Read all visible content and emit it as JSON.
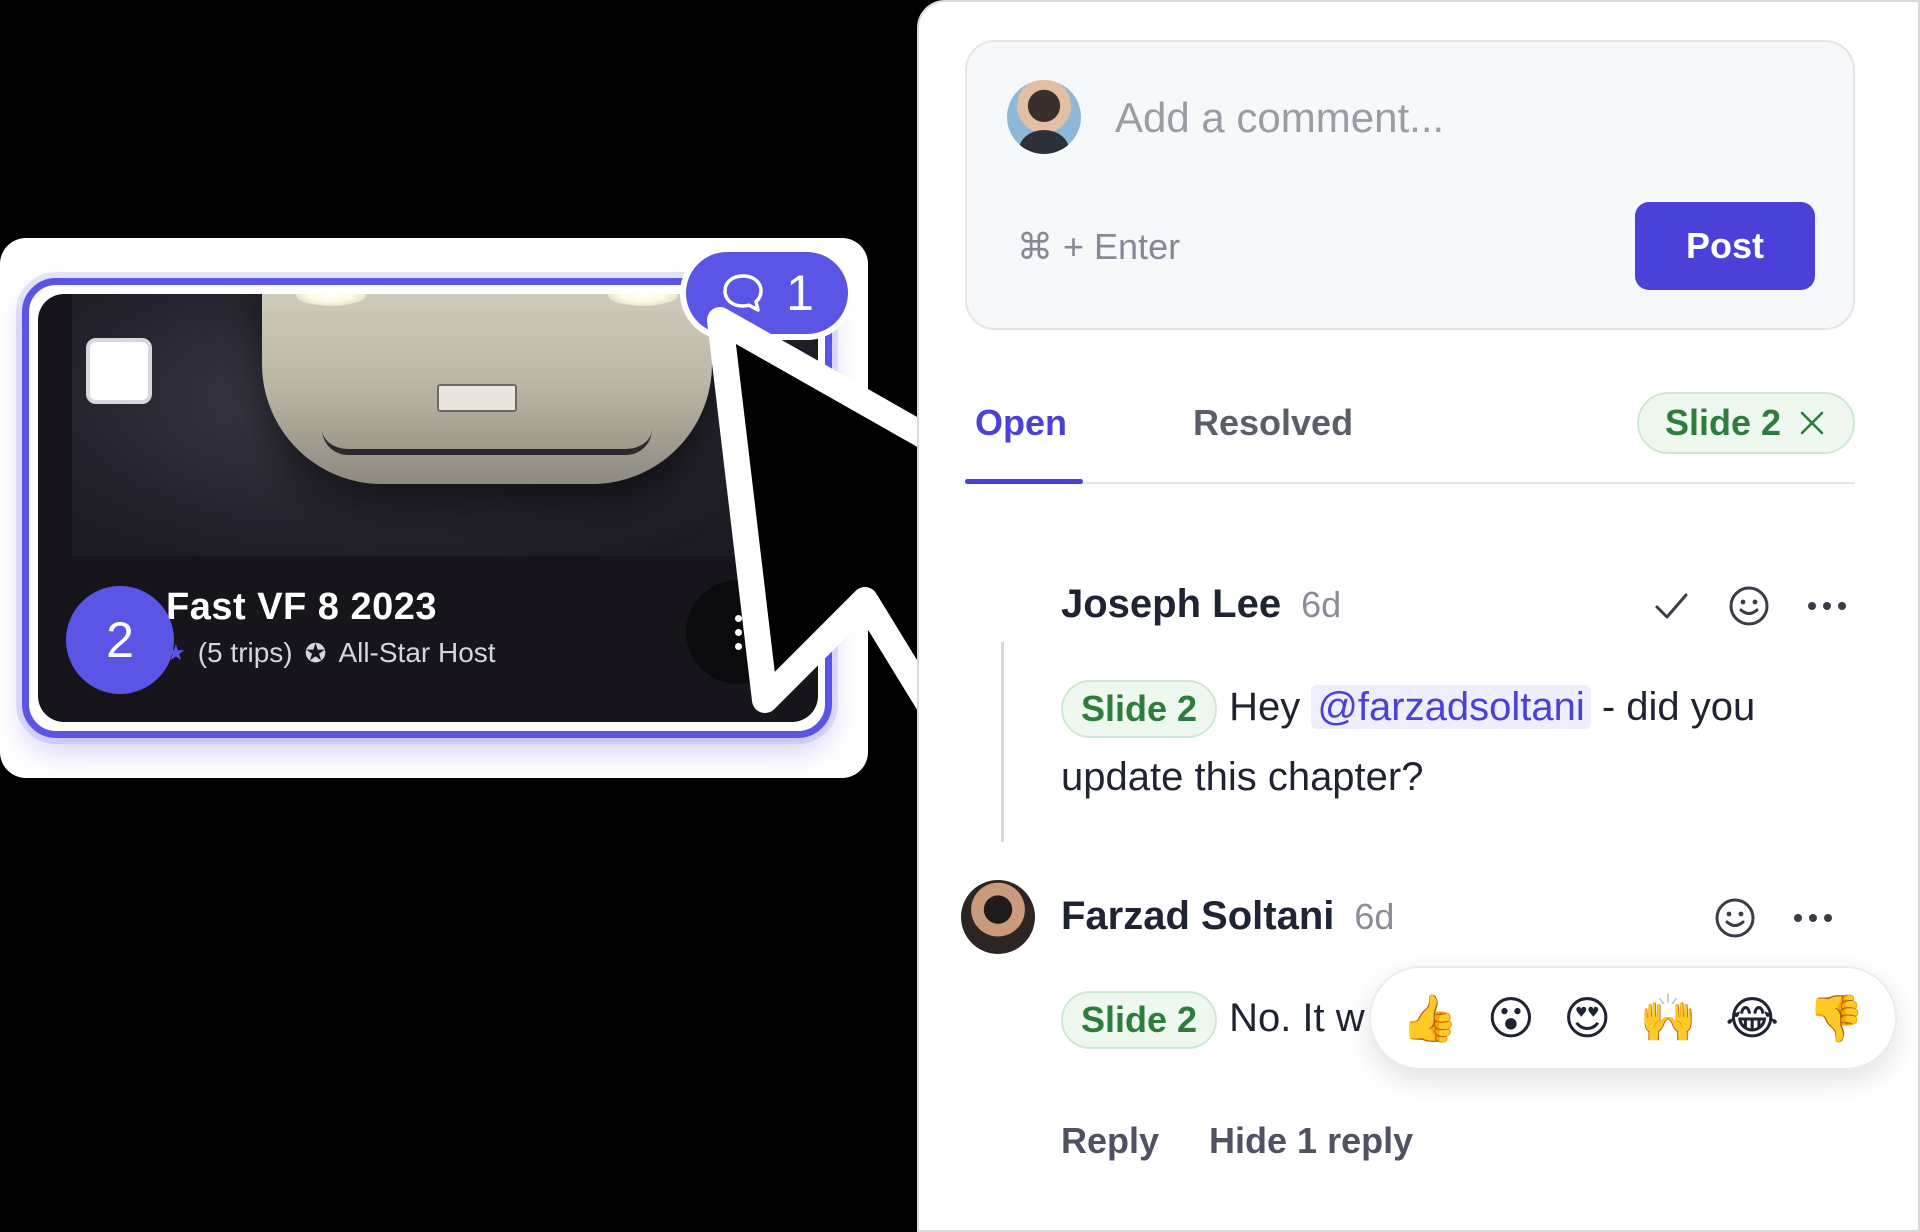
{
  "slide": {
    "number": "2",
    "title": "Fast VF 8 2023",
    "trips": "(5 trips)",
    "host_badge": "All-Star Host",
    "comment_count": "1"
  },
  "composer": {
    "placeholder": "Add a comment...",
    "shortcut": "⌘ + Enter",
    "post_label": "Post"
  },
  "tabs": {
    "open": "Open",
    "resolved": "Resolved",
    "filter_chip": "Slide 2"
  },
  "comments": [
    {
      "author": "Joseph Lee",
      "time": "6d",
      "tag": "Slide 2",
      "text_before": "Hey ",
      "mention": "@farzadsoltani",
      "text_after": " - did you update this chapter?"
    },
    {
      "author": "Farzad Soltani",
      "time": "6d",
      "tag": "Slide 2",
      "text": "No. It w"
    }
  ],
  "reactions": [
    "👍",
    "😮",
    "😍",
    "🙌",
    "😂",
    "👎"
  ],
  "reply_actions": {
    "reply": "Reply",
    "hide": "Hide 1 reply"
  },
  "colors": {
    "accent": "#4b40d8",
    "slide_outline": "#5b55e6",
    "tag_green": "#2e7d3d",
    "tag_bg": "#eef8ef"
  }
}
